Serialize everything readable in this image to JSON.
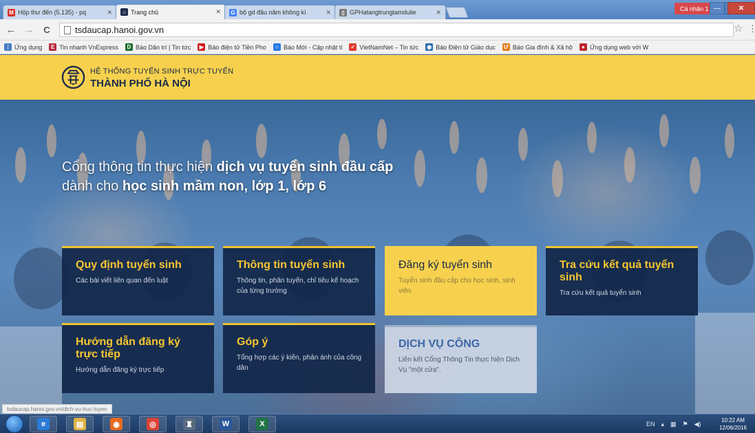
{
  "browser": {
    "tabs": [
      {
        "label": "Hộp thư đến (5.135) - pq",
        "icon": "gmail-icon",
        "color": "#d93025",
        "glyph": "M"
      },
      {
        "label": "Trang chủ",
        "icon": "site-logo-icon",
        "color": "#1b2a4a",
        "glyph": "⌂",
        "active": true
      },
      {
        "label": "bộ gd đầu năm không kì",
        "icon": "google-icon",
        "color": "#4285f4",
        "glyph": "G"
      },
      {
        "label": "GPHatangtrungtamdulie",
        "icon": "document-icon",
        "color": "#777777",
        "glyph": "▯"
      }
    ],
    "profile": "Cá nhân 1",
    "window_buttons": {
      "minimize": "—",
      "maximize": "❐",
      "close": "✕"
    },
    "address": "tsdaucap.hanoi.gov.vn",
    "nav": {
      "back": "←",
      "forward": "→",
      "reload": "C",
      "star": "☆",
      "menu": "⋮"
    },
    "bookmarks": [
      {
        "label": "Ứng dụng",
        "icon": "apps-icon",
        "color": "#4a7cc9",
        "glyph": "⋮"
      },
      {
        "label": "Tin nhanh VnExpress",
        "icon": "vnexpress-icon",
        "color": "#b62a3b",
        "glyph": "E"
      },
      {
        "label": "Báo Dân trí | Tin tức",
        "icon": "dantri-icon",
        "color": "#1d6e2e",
        "glyph": "D"
      },
      {
        "label": "Báo điện tử Tiền Pho",
        "icon": "tienphong-icon",
        "color": "#d21f1f",
        "glyph": "▶"
      },
      {
        "label": "Báo Mới - Cập nhật ti",
        "icon": "baomoi-icon",
        "color": "#2a7be4",
        "glyph": "○"
      },
      {
        "label": "VietNamNet – Tin tức",
        "icon": "vietnamnet-icon",
        "color": "#e23b2e",
        "glyph": "✓"
      },
      {
        "label": "Báo Điện tử Giáo dục",
        "icon": "giaoduc-icon",
        "color": "#2b6cb0",
        "glyph": "◉"
      },
      {
        "label": "Báo Gia đình & Xã hộ",
        "icon": "giadinh-icon",
        "color": "#e07b1f",
        "glyph": "Ư"
      },
      {
        "label": "Ứng dụng web với W",
        "icon": "web-app-icon",
        "color": "#c0262d",
        "glyph": "●"
      }
    ],
    "status_url": "tsdaucap.hanoi.gov.vn/dich-vu-truc-tuyen"
  },
  "site": {
    "small_title": "HỆ THỐNG TUYỂN SINH TRỰC TUYẾN",
    "big_title": "THÀNH PHỐ HÀ NỘI",
    "hero_line1_a": "Cổng thông tin thực hiện ",
    "hero_line1_b": "dịch vụ tuyển sinh đầu cấp",
    "hero_line2_a": "dành cho ",
    "hero_line2_b": "học sinh mầm non, lớp 1, lớp 6",
    "cards": [
      {
        "title": "Quy định tuyển sinh",
        "subtitle": "Các bài viết liên quan đến luật"
      },
      {
        "title": "Thông tin tuyển sinh",
        "subtitle": "Thông tin, phân tuyến, chỉ tiêu kế hoạch của từng trường"
      },
      {
        "title": "Đăng ký tuyển sinh",
        "subtitle": "Tuyển sinh đầu cấp cho học sinh, sinh viên"
      },
      {
        "title": "Tra cứu kết quả tuyển sinh",
        "subtitle": "Tra cứu kết quả tuyển sinh"
      },
      {
        "title": "Hướng dẫn đăng ký trực tiếp",
        "subtitle": "Hướng dẫn đăng ký trực tiếp"
      },
      {
        "title": "Góp ý",
        "subtitle": "Tổng hợp các ý kiến, phản ánh của công dân"
      },
      {
        "title": "DỊCH VỤ CÔNG",
        "subtitle": "Liên kết Cổng Thông Tin thực hiện Dịch Vụ \"một cửa\"."
      }
    ]
  },
  "taskbar": {
    "apps": [
      {
        "icon": "ie-icon",
        "color": "#2b7bd6",
        "glyph": "e"
      },
      {
        "icon": "folder-icon",
        "color": "#e0b446",
        "glyph": "▤"
      },
      {
        "icon": "media-player-icon",
        "color": "#e66a1f",
        "glyph": "◉"
      },
      {
        "icon": "chrome-icon",
        "color": "#db4437",
        "glyph": "◎"
      },
      {
        "icon": "unikey-icon",
        "color": "#5a6b80",
        "glyph": "♜"
      },
      {
        "icon": "word-icon",
        "color": "#2b579a",
        "glyph": "W"
      },
      {
        "icon": "excel-icon",
        "color": "#217346",
        "glyph": "X"
      }
    ],
    "language": "EN",
    "time": "10:22 AM",
    "date": "12/06/2016"
  }
}
